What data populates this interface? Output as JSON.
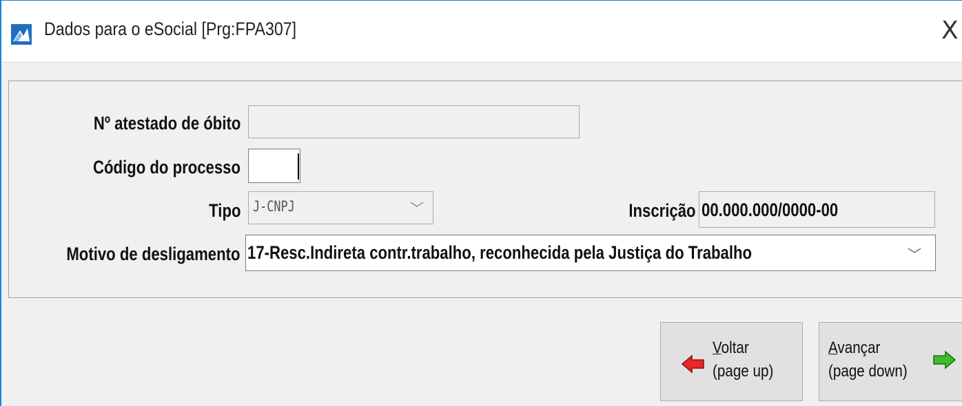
{
  "window": {
    "title": "Dados para o eSocial [Prg:FPA307]",
    "close_symbol": "X",
    "icon": "app-icon"
  },
  "form": {
    "atestado_label": "Nº atestado de óbito",
    "atestado_value": "",
    "codigo_label": "Código do processo",
    "codigo_value": "",
    "tipo_label": "Tipo",
    "tipo_value": "J-CNPJ",
    "inscricao_label": "Inscrição",
    "inscricao_value": "00.000.000/0000-00",
    "motivo_label": "Motivo de desligamento",
    "motivo_value": "17-Resc.Indireta contr.trabalho, reconhecida pela Justiça do Trabalho"
  },
  "buttons": {
    "voltar_line1_mnemonic": "V",
    "voltar_line1_rest": "oltar",
    "voltar_line2": "(page up)",
    "avancar_line1_mnemonic": "A",
    "avancar_line1_rest": "vançar",
    "avancar_line2": "(page down)"
  },
  "colors": {
    "accent": "#1883d7",
    "back_arrow": "#e8262b",
    "forward_arrow": "#3bbf2a"
  },
  "icons": [
    "app-icon",
    "close-icon",
    "chevron-down-icon",
    "red-left-arrow-icon",
    "green-right-arrow-icon"
  ]
}
